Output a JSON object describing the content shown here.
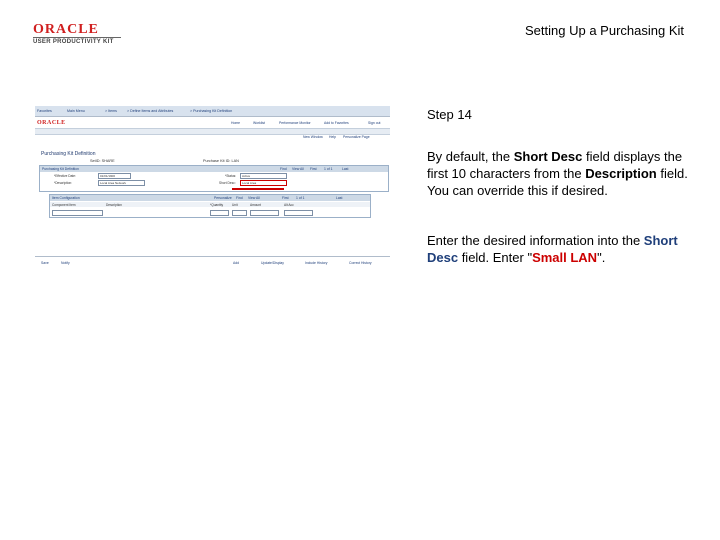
{
  "header": {
    "logo_brand": "ORACLE",
    "logo_product": "USER PRODUCTIVITY KIT",
    "doc_title": "Setting Up a Purchasing Kit"
  },
  "screenshot": {
    "nav_items": [
      "Favorites",
      "Main Menu",
      "> Items",
      "> Define Items and Attributes",
      "> Purchasing Kit Definition"
    ],
    "app_brand": "ORACLE",
    "top_links": [
      "Home",
      "Worklist",
      "Performance Monitor",
      "Add to Favorites",
      "Sign out"
    ],
    "new_window_links": [
      "New Window",
      "Help",
      "Personalize Page"
    ],
    "page_title": "Purchasing Kit Definition",
    "setid_label": "SetID: SHARE",
    "kitid_label": "Purchase Kit ID: LAN",
    "grid1_title": "Purchasing Kit Definition",
    "grid1_nav": [
      "Find",
      "View All",
      "First",
      "1 of 1",
      "Last"
    ],
    "effective_date_label": "*Effective Date:",
    "effective_date_value": "01/01/1900",
    "description_label": "*Description:",
    "description_value": "Local Area Network",
    "status_label": "*Status:",
    "status_value": "Active",
    "short_desc_label": "Short Desc:",
    "short_desc_value": "Local Area",
    "grid2_title": "Item Configuration",
    "grid2_nav": [
      "Personalize",
      "Find",
      "View All",
      "First",
      "1 of 1",
      "Last"
    ],
    "grid2_cols": [
      "Component Item",
      "Description",
      "*Quantity",
      "Unit",
      "Amount",
      "Alt Acc"
    ],
    "bottom_buttons_left": [
      "Save",
      "Notify"
    ],
    "bottom_buttons_right": [
      "Add",
      "Update/Display",
      "Include History",
      "Correct History"
    ]
  },
  "step": {
    "title": "Step 14",
    "p1_a": "By default, the ",
    "p1_b": "Short Desc",
    "p1_c": " field displays the first 10 characters from the ",
    "p1_d": "Description",
    "p1_e": " field. You can override this if desired.",
    "p2_a": "Enter the desired information into the ",
    "p2_b": "Short Desc",
    "p2_c": " field. Enter \"",
    "p2_d": "Small LAN",
    "p2_e": "\"."
  }
}
